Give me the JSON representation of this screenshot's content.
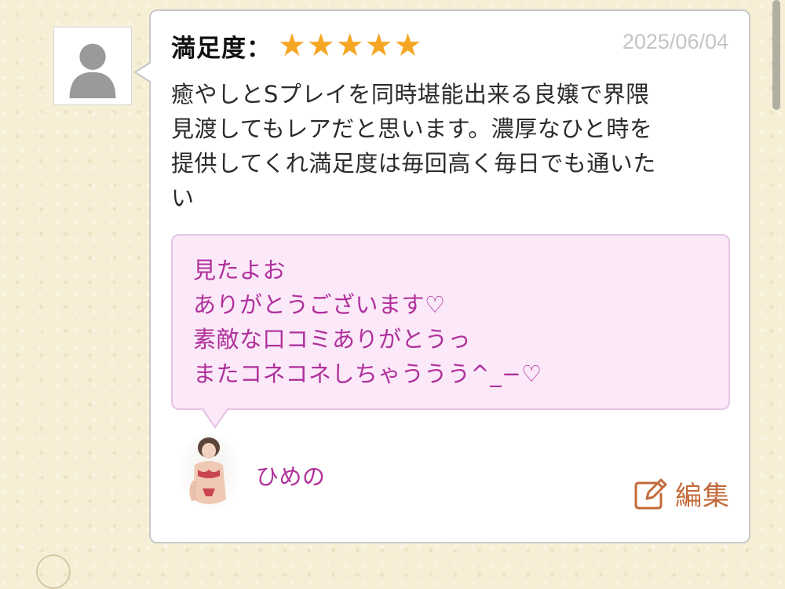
{
  "review": {
    "rating_label": "満足度：",
    "rating": 5,
    "date": "2025/06/04",
    "body": "癒やしとSプレイを同時堪能出来る良嬢で界隈\n見渡してもレアだと思います。濃厚なひと時を\n提供してくれ満足度は毎回高く毎日でも通いた\nい"
  },
  "reply": {
    "text": "見たよお\nありがとうございます♡\n素敵な口コミありがとうっ\nまたコネコネしちゃううう^_−♡",
    "staff_name": "ひめの"
  },
  "actions": {
    "edit_label": "編集",
    "edit_icon": "pencil-square-icon"
  },
  "colors": {
    "star": "#f5a623",
    "reply_text": "#b0309b",
    "reply_bg": "#fbe9f9",
    "edit": "#c26a3a",
    "date": "#c4c4c4"
  }
}
